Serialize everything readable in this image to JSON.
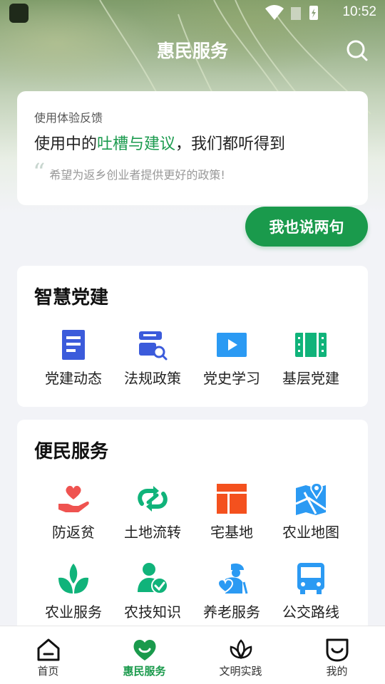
{
  "status_bar": {
    "time": "10:52"
  },
  "header": {
    "title": "惠民服务",
    "search_icon": "search-icon"
  },
  "feedback": {
    "subtitle": "使用体验反馈",
    "headline_prefix": "使用中的",
    "headline_highlight": "吐槽与建议",
    "headline_suffix": "，我们都听得到",
    "quote": "希望为返乡创业者提供更好的政策!",
    "button_label": "我也说两句",
    "accent_color": "#1a9a4c"
  },
  "smart_party": {
    "title": "智慧党建",
    "items": [
      {
        "label": "党建动态",
        "icon": "document-icon",
        "color": "#3b5bdb"
      },
      {
        "label": "法规政策",
        "icon": "law-search-icon",
        "color": "#3b5bdb"
      },
      {
        "label": "党史学习",
        "icon": "video-play-icon",
        "color": "#2b9af3"
      },
      {
        "label": "基层党建",
        "icon": "film-strip-icon",
        "color": "#10b37a"
      }
    ]
  },
  "services": {
    "title": "便民服务",
    "items": [
      {
        "label": "防返贫",
        "icon": "heart-hand-icon",
        "color": "#ef5350"
      },
      {
        "label": "土地流转",
        "icon": "transfer-icon",
        "color": "#10b37a"
      },
      {
        "label": "宅基地",
        "icon": "layout-icon",
        "color": "#f4511e"
      },
      {
        "label": "农业地图",
        "icon": "map-pin-icon",
        "color": "#2b9af3"
      },
      {
        "label": "农业服务",
        "icon": "sprout-icon",
        "color": "#10b37a"
      },
      {
        "label": "农技知识",
        "icon": "person-check-icon",
        "color": "#10b37a"
      },
      {
        "label": "养老服务",
        "icon": "elderly-care-icon",
        "color": "#2b9af3"
      },
      {
        "label": "公交路线",
        "icon": "bus-icon",
        "color": "#2b9af3"
      }
    ]
  },
  "tabbar": {
    "tabs": [
      {
        "label": "首页",
        "icon": "home-icon",
        "active": false
      },
      {
        "label": "惠民服务",
        "icon": "heart-smile-icon",
        "active": true
      },
      {
        "label": "文明实践",
        "icon": "lotus-icon",
        "active": false
      },
      {
        "label": "我的",
        "icon": "smile-face-icon",
        "active": false
      }
    ],
    "active_color": "#1a9a4c"
  }
}
